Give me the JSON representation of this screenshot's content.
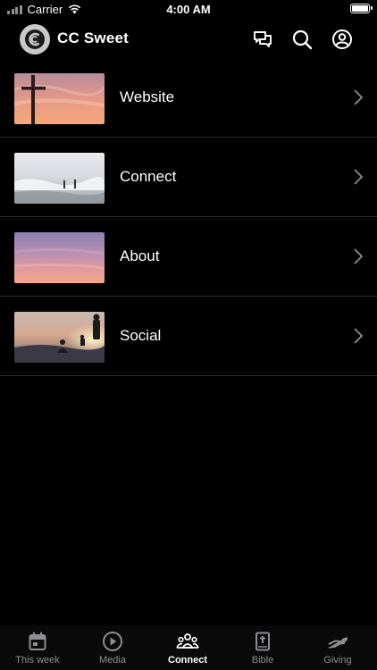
{
  "status_bar": {
    "carrier": "Carrier",
    "time": "4:00 AM"
  },
  "header": {
    "title": "CC Sweet",
    "icons": [
      "chat-bubbles-icon",
      "search-icon",
      "account-icon"
    ]
  },
  "menu_items": [
    {
      "label": "Website",
      "image": "cross-at-sunset"
    },
    {
      "label": "Connect",
      "image": "people-in-surf"
    },
    {
      "label": "About",
      "image": "pink-sunset-sky"
    },
    {
      "label": "Social",
      "image": "friends-on-hilltop"
    }
  ],
  "tab_bar": {
    "tabs": [
      {
        "label": "This week",
        "icon": "calendar-icon",
        "active": false
      },
      {
        "label": "Media",
        "icon": "play-circle-icon",
        "active": false
      },
      {
        "label": "Connect",
        "icon": "group-icon",
        "active": true
      },
      {
        "label": "Bible",
        "icon": "bible-icon",
        "active": false
      },
      {
        "label": "Giving",
        "icon": "giving-hand-icon",
        "active": false
      }
    ]
  },
  "colors": {
    "background": "#000000",
    "divider": "#2c2c2e",
    "inactive_tab": "#8e8e93",
    "active_tab": "#ffffff"
  }
}
